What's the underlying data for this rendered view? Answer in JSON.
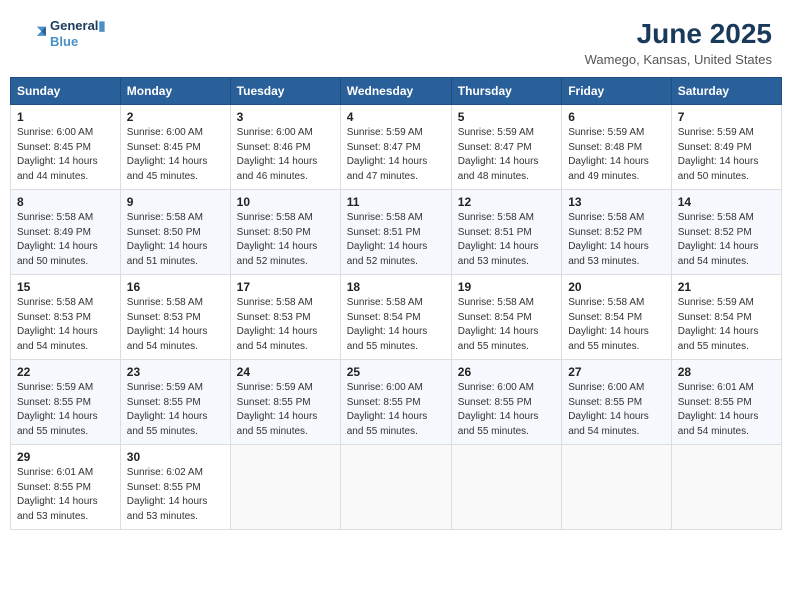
{
  "logo": {
    "line1": "General",
    "line2": "Blue"
  },
  "title": "June 2025",
  "location": "Wamego, Kansas, United States",
  "days_of_week": [
    "Sunday",
    "Monday",
    "Tuesday",
    "Wednesday",
    "Thursday",
    "Friday",
    "Saturday"
  ],
  "weeks": [
    [
      {
        "day": "1",
        "sunrise": "6:00 AM",
        "sunset": "8:45 PM",
        "daylight": "14 hours and 44 minutes."
      },
      {
        "day": "2",
        "sunrise": "6:00 AM",
        "sunset": "8:45 PM",
        "daylight": "14 hours and 45 minutes."
      },
      {
        "day": "3",
        "sunrise": "6:00 AM",
        "sunset": "8:46 PM",
        "daylight": "14 hours and 46 minutes."
      },
      {
        "day": "4",
        "sunrise": "5:59 AM",
        "sunset": "8:47 PM",
        "daylight": "14 hours and 47 minutes."
      },
      {
        "day": "5",
        "sunrise": "5:59 AM",
        "sunset": "8:47 PM",
        "daylight": "14 hours and 48 minutes."
      },
      {
        "day": "6",
        "sunrise": "5:59 AM",
        "sunset": "8:48 PM",
        "daylight": "14 hours and 49 minutes."
      },
      {
        "day": "7",
        "sunrise": "5:59 AM",
        "sunset": "8:49 PM",
        "daylight": "14 hours and 50 minutes."
      }
    ],
    [
      {
        "day": "8",
        "sunrise": "5:58 AM",
        "sunset": "8:49 PM",
        "daylight": "14 hours and 50 minutes."
      },
      {
        "day": "9",
        "sunrise": "5:58 AM",
        "sunset": "8:50 PM",
        "daylight": "14 hours and 51 minutes."
      },
      {
        "day": "10",
        "sunrise": "5:58 AM",
        "sunset": "8:50 PM",
        "daylight": "14 hours and 52 minutes."
      },
      {
        "day": "11",
        "sunrise": "5:58 AM",
        "sunset": "8:51 PM",
        "daylight": "14 hours and 52 minutes."
      },
      {
        "day": "12",
        "sunrise": "5:58 AM",
        "sunset": "8:51 PM",
        "daylight": "14 hours and 53 minutes."
      },
      {
        "day": "13",
        "sunrise": "5:58 AM",
        "sunset": "8:52 PM",
        "daylight": "14 hours and 53 minutes."
      },
      {
        "day": "14",
        "sunrise": "5:58 AM",
        "sunset": "8:52 PM",
        "daylight": "14 hours and 54 minutes."
      }
    ],
    [
      {
        "day": "15",
        "sunrise": "5:58 AM",
        "sunset": "8:53 PM",
        "daylight": "14 hours and 54 minutes."
      },
      {
        "day": "16",
        "sunrise": "5:58 AM",
        "sunset": "8:53 PM",
        "daylight": "14 hours and 54 minutes."
      },
      {
        "day": "17",
        "sunrise": "5:58 AM",
        "sunset": "8:53 PM",
        "daylight": "14 hours and 54 minutes."
      },
      {
        "day": "18",
        "sunrise": "5:58 AM",
        "sunset": "8:54 PM",
        "daylight": "14 hours and 55 minutes."
      },
      {
        "day": "19",
        "sunrise": "5:58 AM",
        "sunset": "8:54 PM",
        "daylight": "14 hours and 55 minutes."
      },
      {
        "day": "20",
        "sunrise": "5:58 AM",
        "sunset": "8:54 PM",
        "daylight": "14 hours and 55 minutes."
      },
      {
        "day": "21",
        "sunrise": "5:59 AM",
        "sunset": "8:54 PM",
        "daylight": "14 hours and 55 minutes."
      }
    ],
    [
      {
        "day": "22",
        "sunrise": "5:59 AM",
        "sunset": "8:55 PM",
        "daylight": "14 hours and 55 minutes."
      },
      {
        "day": "23",
        "sunrise": "5:59 AM",
        "sunset": "8:55 PM",
        "daylight": "14 hours and 55 minutes."
      },
      {
        "day": "24",
        "sunrise": "5:59 AM",
        "sunset": "8:55 PM",
        "daylight": "14 hours and 55 minutes."
      },
      {
        "day": "25",
        "sunrise": "6:00 AM",
        "sunset": "8:55 PM",
        "daylight": "14 hours and 55 minutes."
      },
      {
        "day": "26",
        "sunrise": "6:00 AM",
        "sunset": "8:55 PM",
        "daylight": "14 hours and 55 minutes."
      },
      {
        "day": "27",
        "sunrise": "6:00 AM",
        "sunset": "8:55 PM",
        "daylight": "14 hours and 54 minutes."
      },
      {
        "day": "28",
        "sunrise": "6:01 AM",
        "sunset": "8:55 PM",
        "daylight": "14 hours and 54 minutes."
      }
    ],
    [
      {
        "day": "29",
        "sunrise": "6:01 AM",
        "sunset": "8:55 PM",
        "daylight": "14 hours and 53 minutes."
      },
      {
        "day": "30",
        "sunrise": "6:02 AM",
        "sunset": "8:55 PM",
        "daylight": "14 hours and 53 minutes."
      },
      null,
      null,
      null,
      null,
      null
    ]
  ]
}
